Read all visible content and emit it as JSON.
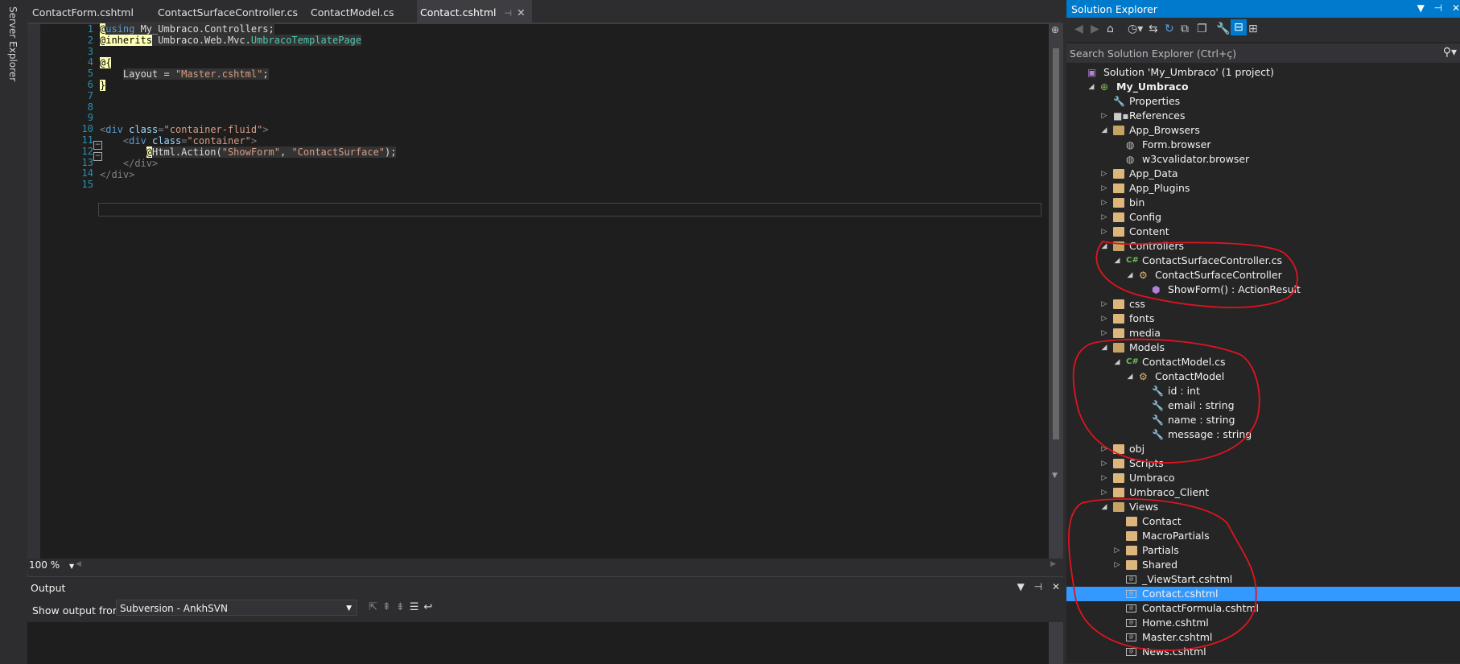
{
  "left_strip": {
    "label": "Server Explorer"
  },
  "tabs": [
    {
      "label": "ContactForm.cshtml"
    },
    {
      "label": "ContactSurfaceController.cs"
    },
    {
      "label": "ContactModel.cs"
    },
    {
      "label": "Contact.cshtml",
      "active": true
    }
  ],
  "editor": {
    "line_numbers": [
      "1",
      "2",
      "3",
      "4",
      "5",
      "6",
      "7",
      "8",
      "9",
      "10",
      "11",
      "12",
      "13",
      "14",
      "15"
    ],
    "lines": {
      "l1_at": "@",
      "l1_using": "using",
      "l1_rest": " My_Umbraco.Controllers;",
      "l2_inherits": "@inherits",
      "l2_ns": " Umbraco.Web.Mvc.",
      "l2_type": "UmbracoTemplatePage",
      "l4": "@{",
      "l5_key": "Layout = ",
      "l5_val": "\"Master.cshtml\"",
      "l5_end": ";",
      "l6": "}",
      "l10_open": "<",
      "l10_tag": "div",
      "l10_attr": " class",
      "l10_eq": "=",
      "l10_val": "\"container-fluid\"",
      "l10_close": ">",
      "l11_open": "<",
      "l11_tag": "div",
      "l11_attr": " class",
      "l11_eq": "=",
      "l11_val": "\"container\"",
      "l11_close": ">",
      "l12_at": "@",
      "l12_call": "Html.Action(",
      "l12_a1": "\"ShowForm\"",
      "l12_sep": ", ",
      "l12_a2": "\"ContactSurface\"",
      "l12_end": ");",
      "l13": "</div>",
      "l14": "</div>"
    },
    "zoom": "100 %"
  },
  "output": {
    "title": "Output",
    "show_label": "Show output from:",
    "source": "Subversion - AnkhSVN"
  },
  "solution_explorer": {
    "title": "Solution Explorer",
    "search_placeholder": "Search Solution Explorer (Ctrl+ç)",
    "nodes": [
      {
        "label": "Solution 'My_Umbraco' (1 project)",
        "level": 0,
        "icon": "solution-icon",
        "exp": ""
      },
      {
        "label": "My_Umbraco",
        "level": 1,
        "icon": "project-icon",
        "exp": "open",
        "bold": true
      },
      {
        "label": "Properties",
        "level": 2,
        "icon": "wrench-icon",
        "exp": ""
      },
      {
        "label": "References",
        "level": 2,
        "icon": "references-icon",
        "exp": "closed"
      },
      {
        "label": "App_Browsers",
        "level": 2,
        "icon": "folder-open-icon",
        "exp": "open"
      },
      {
        "label": "Form.browser",
        "level": 3,
        "icon": "browser-file-icon",
        "exp": ""
      },
      {
        "label": "w3cvalidator.browser",
        "level": 3,
        "icon": "browser-file-icon",
        "exp": ""
      },
      {
        "label": "App_Data",
        "level": 2,
        "icon": "folder-icon",
        "exp": "closed"
      },
      {
        "label": "App_Plugins",
        "level": 2,
        "icon": "folder-icon",
        "exp": "closed"
      },
      {
        "label": "bin",
        "level": 2,
        "icon": "folder-icon",
        "exp": "closed"
      },
      {
        "label": "Config",
        "level": 2,
        "icon": "folder-icon",
        "exp": "closed"
      },
      {
        "label": "Content",
        "level": 2,
        "icon": "folder-icon",
        "exp": "closed"
      },
      {
        "label": "Controllers",
        "level": 2,
        "icon": "folder-open-icon",
        "exp": "open"
      },
      {
        "label": "ContactSurfaceController.cs",
        "level": 3,
        "icon": "csharp-file-icon",
        "exp": "open"
      },
      {
        "label": "ContactSurfaceController",
        "level": 4,
        "icon": "class-icon",
        "exp": "open"
      },
      {
        "label": "ShowForm() : ActionResult",
        "level": 5,
        "icon": "method-icon",
        "exp": ""
      },
      {
        "label": "css",
        "level": 2,
        "icon": "folder-icon",
        "exp": "closed"
      },
      {
        "label": "fonts",
        "level": 2,
        "icon": "folder-icon",
        "exp": "closed"
      },
      {
        "label": "media",
        "level": 2,
        "icon": "folder-icon",
        "exp": "closed"
      },
      {
        "label": "Models",
        "level": 2,
        "icon": "folder-open-icon",
        "exp": "open"
      },
      {
        "label": "ContactModel.cs",
        "level": 3,
        "icon": "csharp-file-icon",
        "exp": "open"
      },
      {
        "label": "ContactModel",
        "level": 4,
        "icon": "class-icon",
        "exp": "open"
      },
      {
        "label": "id : int",
        "level": 5,
        "icon": "property-icon",
        "exp": ""
      },
      {
        "label": "email : string",
        "level": 5,
        "icon": "property-icon",
        "exp": ""
      },
      {
        "label": "name : string",
        "level": 5,
        "icon": "property-icon",
        "exp": ""
      },
      {
        "label": "message : string",
        "level": 5,
        "icon": "property-icon",
        "exp": ""
      },
      {
        "label": "obj",
        "level": 2,
        "icon": "folder-icon",
        "exp": "closed"
      },
      {
        "label": "Scripts",
        "level": 2,
        "icon": "folder-icon",
        "exp": "closed"
      },
      {
        "label": "Umbraco",
        "level": 2,
        "icon": "folder-icon",
        "exp": "closed"
      },
      {
        "label": "Umbraco_Client",
        "level": 2,
        "icon": "folder-icon",
        "exp": "closed"
      },
      {
        "label": "Views",
        "level": 2,
        "icon": "folder-open-icon",
        "exp": "open"
      },
      {
        "label": "Contact",
        "level": 3,
        "icon": "folder-icon",
        "exp": ""
      },
      {
        "label": "MacroPartials",
        "level": 3,
        "icon": "folder-icon",
        "exp": ""
      },
      {
        "label": "Partials",
        "level": 3,
        "icon": "folder-icon",
        "exp": "closed"
      },
      {
        "label": "Shared",
        "level": 3,
        "icon": "folder-icon",
        "exp": "closed"
      },
      {
        "label": "_ViewStart.cshtml",
        "level": 3,
        "icon": "cshtml-file-icon",
        "exp": ""
      },
      {
        "label": "Contact.cshtml",
        "level": 3,
        "icon": "cshtml-file-icon",
        "exp": "",
        "selected": true
      },
      {
        "label": "ContactFormula.cshtml",
        "level": 3,
        "icon": "cshtml-file-icon",
        "exp": ""
      },
      {
        "label": "Home.cshtml",
        "level": 3,
        "icon": "cshtml-file-icon",
        "exp": ""
      },
      {
        "label": "Master.cshtml",
        "level": 3,
        "icon": "cshtml-file-icon",
        "exp": ""
      },
      {
        "label": "News.cshtml",
        "level": 3,
        "icon": "cshtml-file-icon",
        "exp": ""
      }
    ]
  },
  "colors": {
    "accent": "#007acc",
    "selection": "#3399ff",
    "annotation": "#e0141e"
  }
}
